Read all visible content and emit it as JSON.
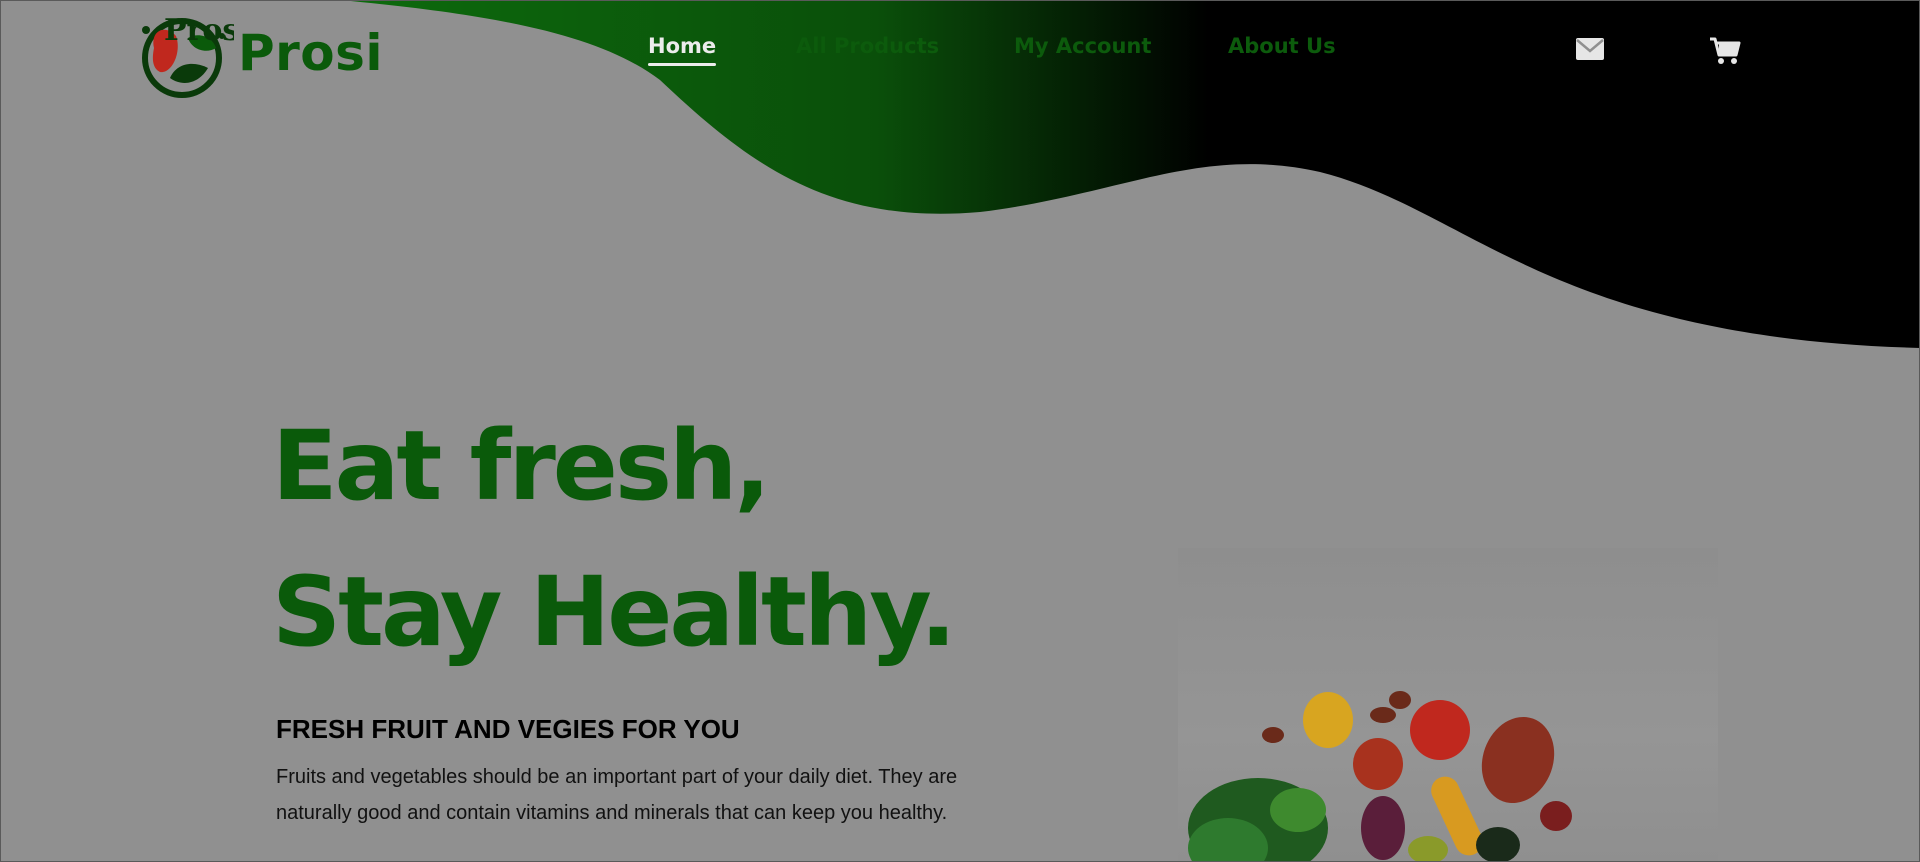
{
  "brand": {
    "name": "Prosi",
    "emblem_text": "Prosi"
  },
  "nav": {
    "items": [
      {
        "label": "Home",
        "active": true
      },
      {
        "label": "All Products",
        "active": false
      },
      {
        "label": "My Account",
        "active": false
      },
      {
        "label": "About Us",
        "active": false
      }
    ]
  },
  "header_icons": [
    "envelope-icon",
    "shopping-cart-icon"
  ],
  "hero": {
    "line1": "Eat fresh,",
    "line2": "Stay Healthy.",
    "subheading": "FRESH FRUIT AND VEGIES FOR YOU",
    "description": "Fruits and vegetables should be an important part of your daily diet. They are naturally good and contain vitamins and minerals that can keep you healthy."
  },
  "colors": {
    "brand_green": "#0a5a0a",
    "wave_green": "#0d6b0d",
    "wave_black": "#000000",
    "page_background": "#909090",
    "active_nav": "#ececec"
  }
}
